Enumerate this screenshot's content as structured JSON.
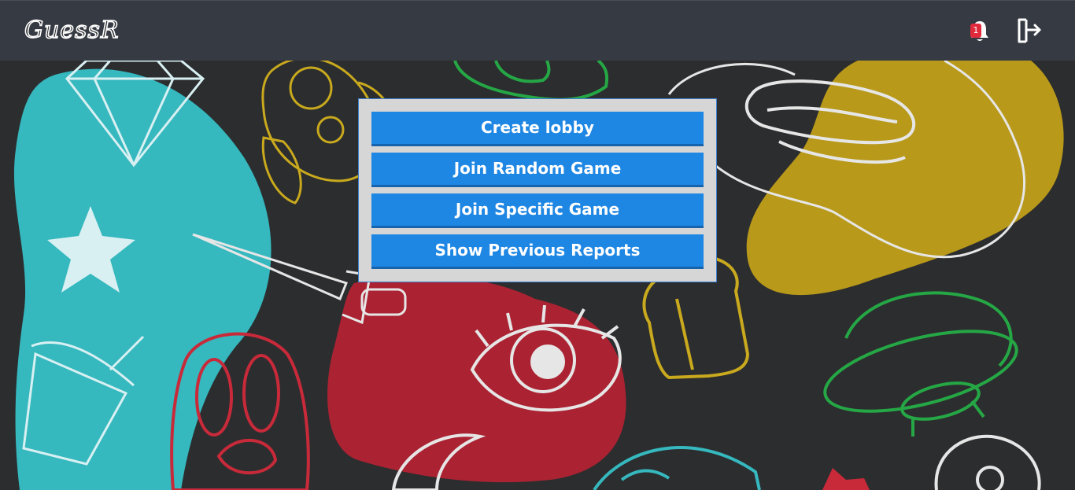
{
  "app": {
    "logo_text": "GuessR"
  },
  "navbar": {
    "notifications": {
      "icon": "bell-icon",
      "count": "1",
      "badge_color": "#e12b3c"
    },
    "logout": {
      "icon": "logout-icon"
    },
    "background_color": "#363a42"
  },
  "menu": {
    "buttons": [
      {
        "id": "create",
        "label": "Create lobby"
      },
      {
        "id": "random",
        "label": "Join Random Game"
      },
      {
        "id": "specific",
        "label": "Join Specific Game"
      },
      {
        "id": "reports",
        "label": "Show Previous Reports"
      }
    ],
    "button_color": "#1e86e3",
    "panel_color": "#d6d6d6"
  },
  "background": {
    "base_color": "#2c2d2f",
    "blob_colors": [
      "#35b8be",
      "#b8991a",
      "#ab2332"
    ],
    "doodle_colors": [
      "#ffffff",
      "#25a745",
      "#c9a91d",
      "#c82a3a",
      "#35b8be"
    ]
  }
}
